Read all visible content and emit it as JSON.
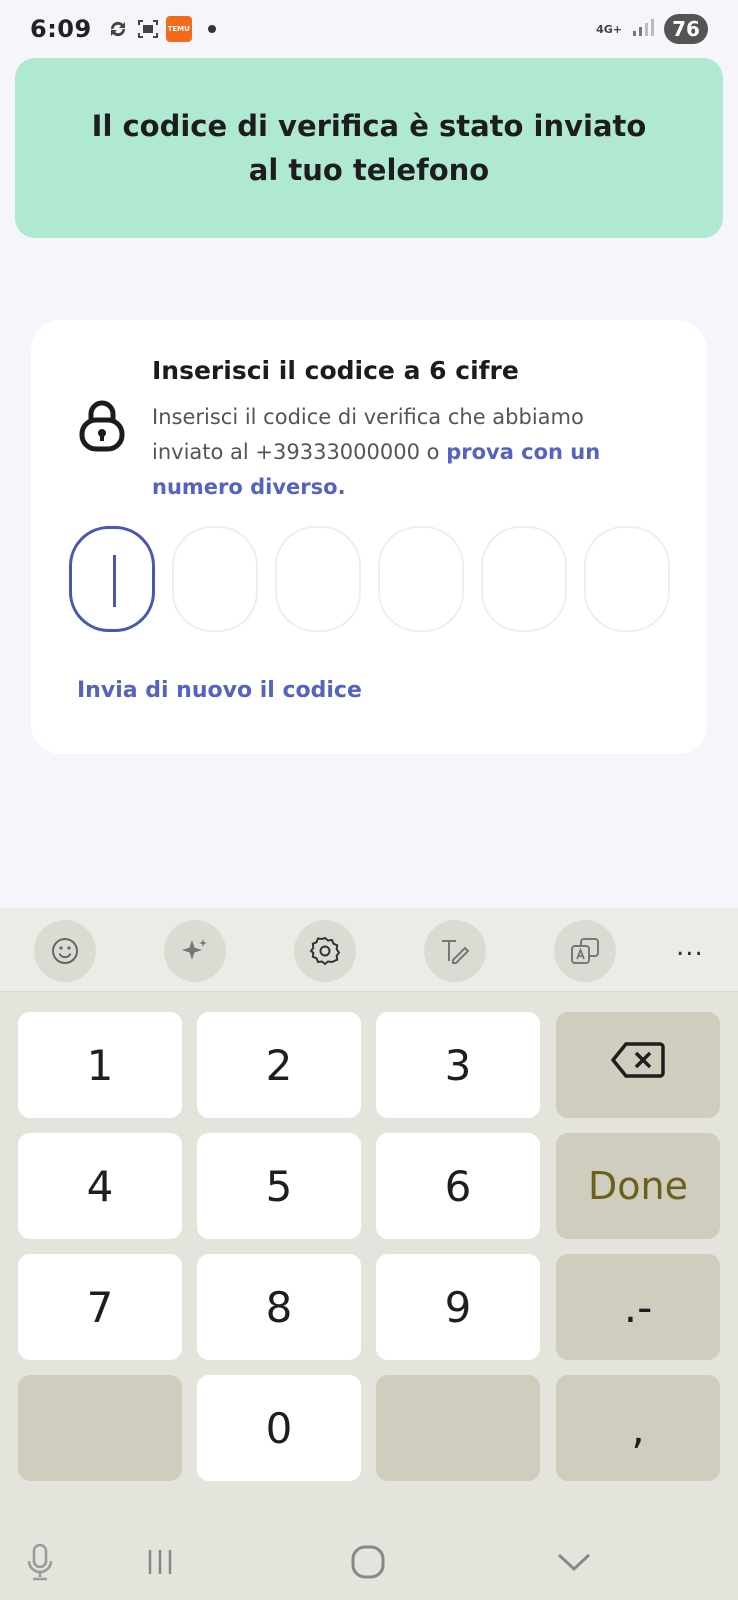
{
  "status_bar": {
    "time": "6:09",
    "network": "4G+",
    "battery": "76",
    "temu_label": "TEMU"
  },
  "toast": {
    "message": "Il codice di verifica è stato inviato al tuo telefono",
    "bg_color": "#afe9d1"
  },
  "card": {
    "title": "Inserisci il codice a 6 cifre",
    "description": "Inserisci il codice di verifica che abbiamo inviato al +39333000000 o ",
    "link": "prova con un numero diverso.",
    "resend": "Invia di nuovo il codice",
    "code_length": 6,
    "accent_color": "#5563c1"
  },
  "keyboard": {
    "toolbar": {
      "icons": [
        "emoji-icon",
        "sparkle-icon",
        "settings-icon",
        "handwriting-icon",
        "translate-icon",
        "more-icon"
      ],
      "more": "..."
    },
    "keys": {
      "k1": "1",
      "k2": "2",
      "k3": "3",
      "k4": "4",
      "k5": "5",
      "k6": "6",
      "k7": "7",
      "k8": "8",
      "k9": "9",
      "k0": "0",
      "done": "Done",
      "dot_dash": ".-",
      "comma": ","
    }
  },
  "nav": {
    "icons": [
      "mic-icon",
      "recents-icon",
      "home-icon",
      "hide-keyboard-icon"
    ]
  }
}
